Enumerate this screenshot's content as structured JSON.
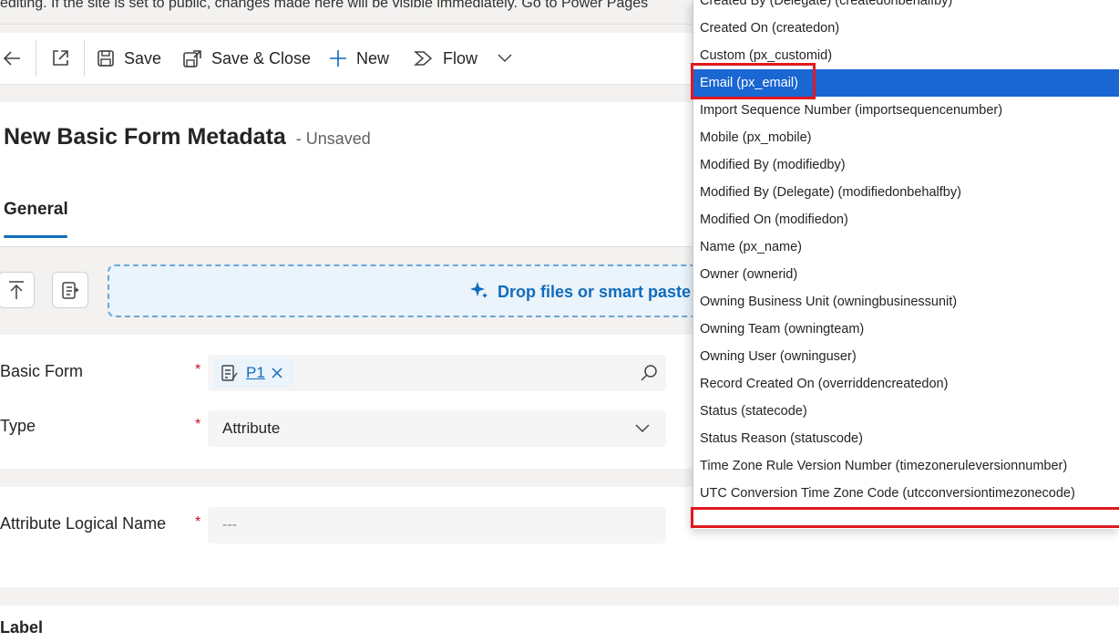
{
  "banner": {
    "text": "editing. If the site is set to public, changes made here will be visible immediately. Go to Power Pages"
  },
  "toolbar": {
    "back_icon": "arrow-left-icon",
    "popout_icon": "open-in-new-window-icon",
    "save_label": "Save",
    "save_close_label": "Save & Close",
    "new_label": "New",
    "flow_label": "Flow"
  },
  "header": {
    "title": "New Basic Form Metadata",
    "status": "- Unsaved",
    "tab_general": "General"
  },
  "upload": {
    "dropzone_text": "Drop files or smart paste fo"
  },
  "form": {
    "basic_form_label": "Basic Form",
    "basic_form_value": "P1",
    "type_label": "Type",
    "type_value": "Attribute",
    "attribute_logical_name_label": "Attribute Logical Name",
    "attribute_logical_name_placeholder": "---",
    "label_heading": "Label",
    "required_mark": "*"
  },
  "dropdown": {
    "selected_index": 3,
    "options": [
      "Created By (Delegate) (createdonbehalfby)",
      "Created On (createdon)",
      "Custom (px_customid)",
      "Email (px_email)",
      "Import Sequence Number (importsequencenumber)",
      "Mobile (px_mobile)",
      "Modified By (modifiedby)",
      "Modified By (Delegate) (modifiedonbehalfby)",
      "Modified On (modifiedon)",
      "Name (px_name)",
      "Owner (ownerid)",
      "Owning Business Unit (owningbusinessunit)",
      "Owning Team (owningteam)",
      "Owning User (owninguser)",
      "Record Created On (overriddencreatedon)",
      "Status (statecode)",
      "Status Reason (statuscode)",
      "Time Zone Rule Version Number (timezoneruleversionnumber)",
      "UTC Conversion Time Zone Code (utcconversiontimezonecode)"
    ]
  },
  "colors": {
    "accent": "#0f6cbd",
    "selected_option": "#1a66d2",
    "highlight_box": "#e0191f",
    "required": "#c50f1f"
  }
}
